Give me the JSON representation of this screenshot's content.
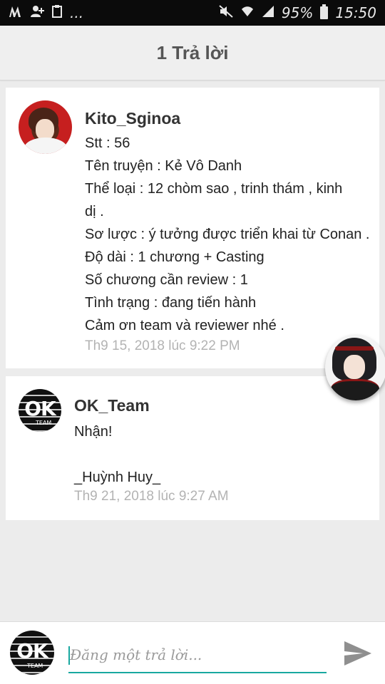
{
  "status_bar": {
    "left_icons": [
      "m-app-icon",
      "add-user-icon",
      "clipboard-icon",
      "more-dots-icon"
    ],
    "more_label": "...",
    "right_icons": [
      "mute-icon",
      "wifi-icon",
      "signal-icon"
    ],
    "battery": "95%",
    "time": "15:50"
  },
  "header": {
    "title": "1 Trả lời"
  },
  "comments": [
    {
      "author": "Kito_Sginoa",
      "lines": [
        "Stt : 56",
        "Tên truyện : Kẻ Vô Danh",
        "Thể loại : 12 chòm sao , trinh thám , kinh",
        "dị .",
        "Sơ lược : ý tưởng được triển khai từ Conan .",
        "Độ dài : 1 chương + Casting",
        "Số chương cần review : 1",
        "Tình trạng : đang tiến hành",
        "Cảm ơn team và reviewer nhé ."
      ],
      "timestamp": "Th9 15, 2018 lúc 9:22 PM"
    },
    {
      "author": "OK_Team",
      "lines": [
        "Nhận!",
        "",
        "_Huỳnh Huy_"
      ],
      "timestamp": "Th9 21, 2018 lúc 9:27 AM"
    }
  ],
  "avatar_logo": {
    "ok": "OK",
    "team": "TEAM"
  },
  "reply": {
    "placeholder": "Đăng một trả lời..."
  },
  "colors": {
    "accent": "#18a8a0",
    "timestamp": "#b3b3b3",
    "background": "#ececec"
  }
}
